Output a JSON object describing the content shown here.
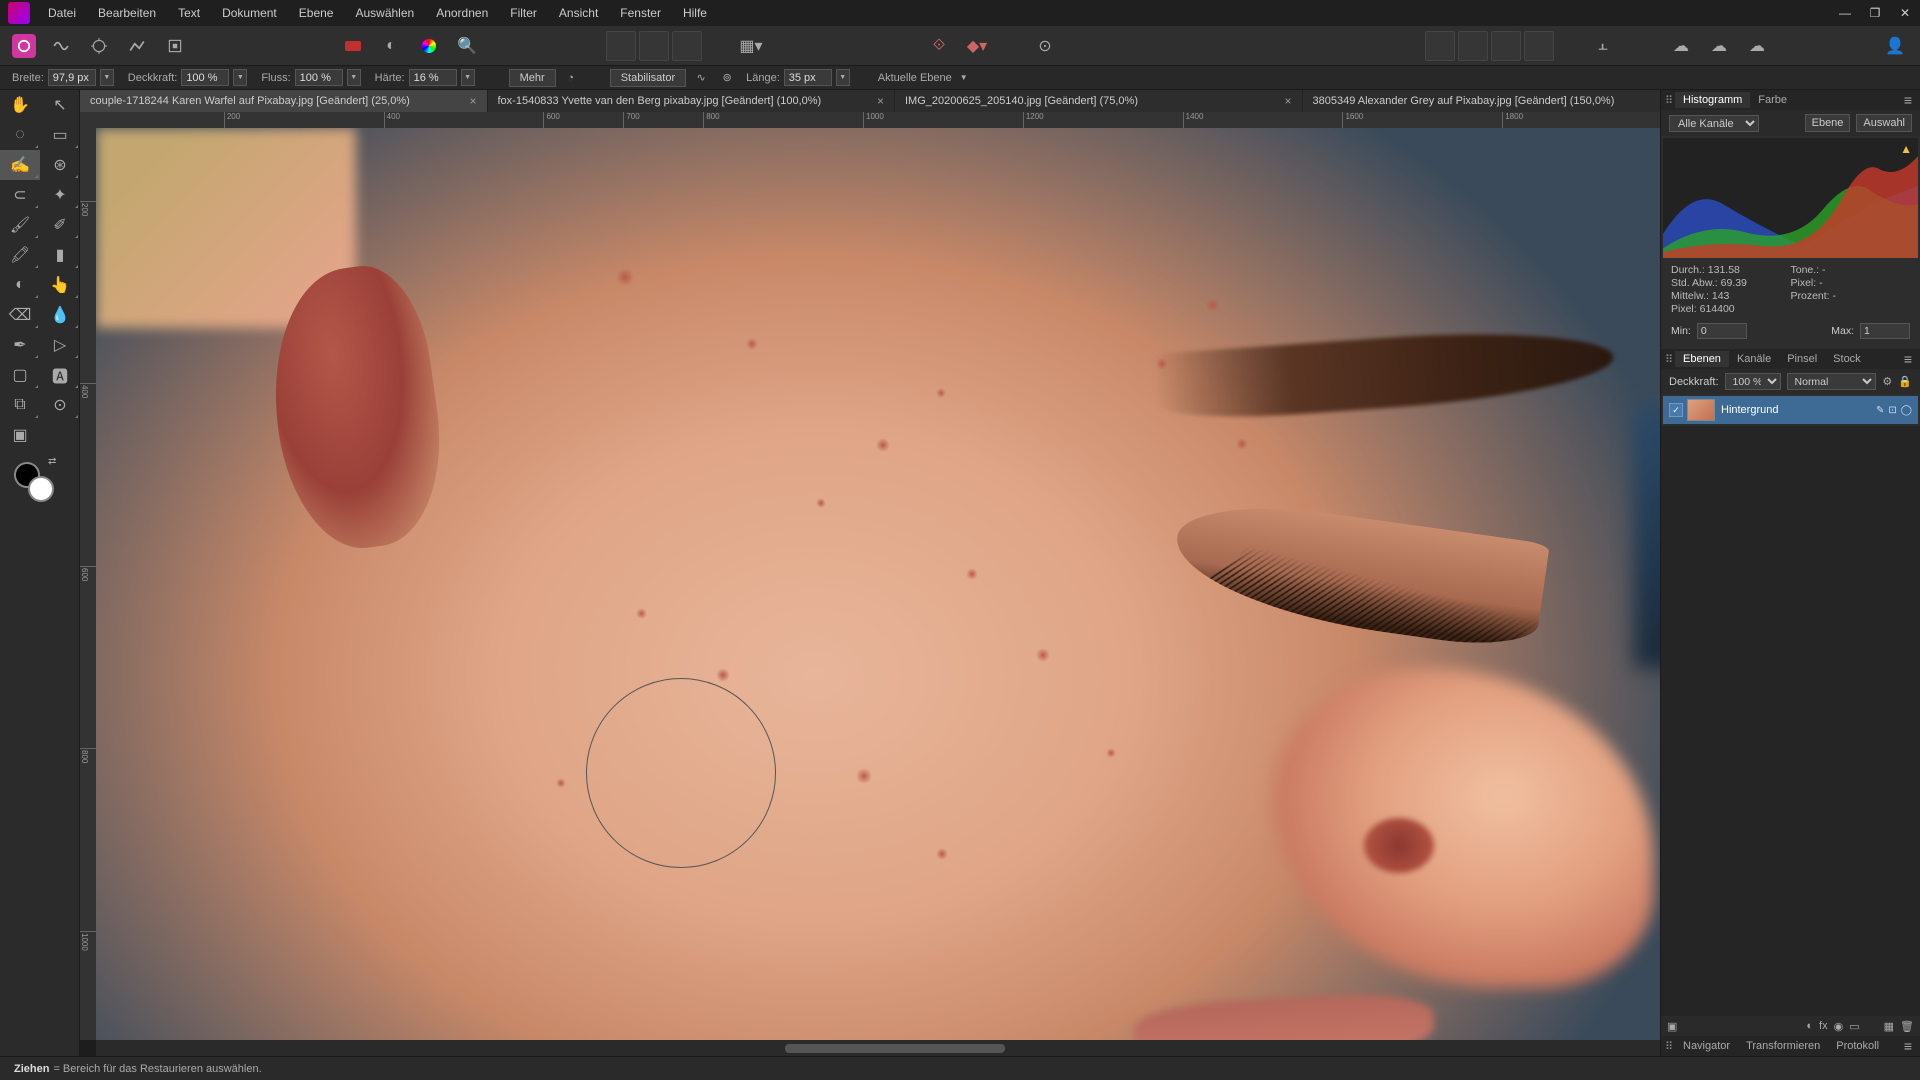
{
  "menu": [
    "Datei",
    "Bearbeiten",
    "Text",
    "Dokument",
    "Ebene",
    "Auswählen",
    "Anordnen",
    "Filter",
    "Ansicht",
    "Fenster",
    "Hilfe"
  ],
  "context_toolbar": {
    "width_label": "Breite:",
    "width_value": "97,9 px",
    "opacity_label": "Deckkraft:",
    "opacity_value": "100 %",
    "flow_label": "Fluss:",
    "flow_value": "100 %",
    "hardness_label": "Härte:",
    "hardness_value": "16 %",
    "more_label": "Mehr",
    "stabilizer_label": "Stabilisator",
    "length_label": "Länge:",
    "length_value": "35 px",
    "target_label": "Aktuelle Ebene"
  },
  "doc_tabs": [
    {
      "name": "couple-1718244 Karen Warfel auf Pixabay.jpg [Geändert] (25,0%)",
      "active": true
    },
    {
      "name": "fox-1540833 Yvette van den Berg pixabay.jpg [Geändert] (100,0%)",
      "active": false
    },
    {
      "name": "IMG_20200625_205140.jpg [Geändert] (75,0%)",
      "active": false
    },
    {
      "name": "3805349 Alexander Grey auf Pixabay.jpg [Geändert] (150,0%)",
      "active": false
    }
  ],
  "ruler_marks_h": [
    "200",
    "400",
    "600",
    "700",
    "800",
    "1000",
    "1200",
    "1400",
    "1600",
    "1800"
  ],
  "ruler_marks_v": [
    "200",
    "400",
    "600",
    "800",
    "1000"
  ],
  "histogram_panel": {
    "tabs": [
      "Histogramm",
      "Farbe"
    ],
    "channel_label": "Alle Kanäle",
    "btn_layer": "Ebene",
    "btn_selection": "Auswahl",
    "stats": {
      "mean_label": "Durch.:",
      "mean": "131.58",
      "std_label": "Std. Abw.:",
      "std": "69.39",
      "median_label": "Mittelw.:",
      "median": "143",
      "pixels_label": "Pixel:",
      "pixels": "614400",
      "tone_label": "Tone.:",
      "tone": "-",
      "pos_label": "Pixel:",
      "pos": "-",
      "percent_label": "Prozent:",
      "percent": "-"
    },
    "min_label": "Min:",
    "min_value": "0",
    "max_label": "Max:",
    "max_value": "1"
  },
  "layers_panel": {
    "tabs": [
      "Ebenen",
      "Kanäle",
      "Pinsel",
      "Stock"
    ],
    "opacity_label": "Deckkraft:",
    "opacity_value": "100 %",
    "blend_value": "Normal",
    "layer_name": "Hintergrund"
  },
  "bottom_panel_tabs": [
    "Navigator",
    "Transformieren",
    "Protokoll"
  ],
  "status": {
    "action": "Ziehen",
    "hint": " = Bereich für das Restaurieren auswählen."
  }
}
